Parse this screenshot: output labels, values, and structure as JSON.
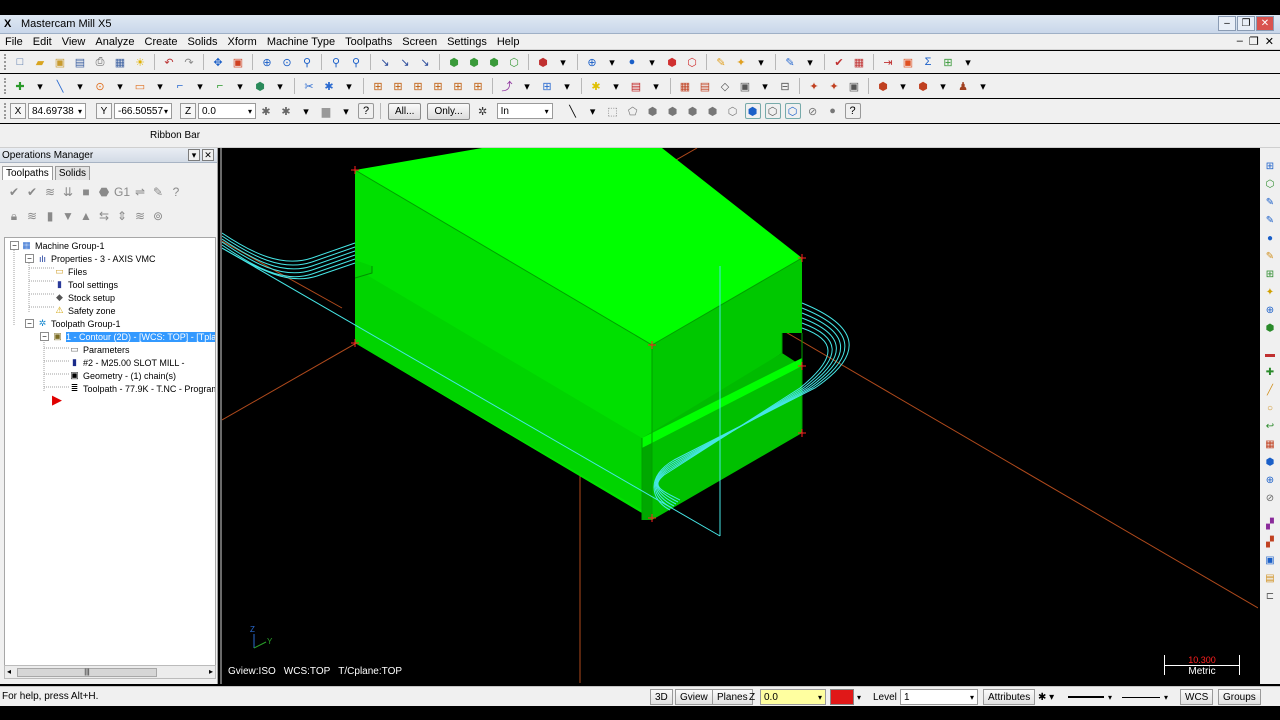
{
  "window": {
    "title": "Mastercam Mill X5",
    "controls": [
      "–",
      "❐",
      "✕"
    ]
  },
  "menubar": {
    "items": [
      "File",
      "Edit",
      "View",
      "Analyze",
      "Create",
      "Solids",
      "Xform",
      "Machine Type",
      "Toolpaths",
      "Screen",
      "Settings",
      "Help"
    ],
    "right": [
      "–",
      "❐",
      "✕"
    ]
  },
  "autocursor": {
    "x_label": "X",
    "x_value": "84.69738",
    "y_label": "Y",
    "y_value": "-66.50557",
    "z_label": "Z",
    "z_value": "0.0",
    "all_button": "All...",
    "only_button": "Only...",
    "mode_select": "In"
  },
  "ribbon": {
    "label": "Ribbon Bar"
  },
  "ops_manager": {
    "title": "Operations Manager",
    "tabs": [
      "Toolpaths",
      "Solids"
    ],
    "tree": [
      {
        "label": "Machine Group-1"
      },
      {
        "label": "Properties - 3 - AXIS VMC"
      },
      {
        "label": "Files"
      },
      {
        "label": "Tool settings"
      },
      {
        "label": "Stock setup"
      },
      {
        "label": "Safety zone"
      },
      {
        "label": "Toolpath Group-1"
      },
      {
        "label": "1 - Contour (2D) - [WCS: TOP] - [Tpla"
      },
      {
        "label": "Parameters"
      },
      {
        "label": "#2 - M25.00 SLOT MILL -"
      },
      {
        "label": "Geometry - (1) chain(s)"
      },
      {
        "label": "Toolpath - 77.9K - T.NC - Program"
      }
    ],
    "scroll_thumb": "|||"
  },
  "viewport": {
    "gview": "Gview:ISO",
    "wcs": "WCS:TOP",
    "tcplane": "T/Cplane:TOP",
    "axis_y": "Y",
    "axis_z": "Z",
    "scale_value": "10.300",
    "scale_unit": "Metric",
    "colors": {
      "part": "#00ff00",
      "toolpath": "#46e6e6",
      "axis_line": "#c04020"
    }
  },
  "statusbar": {
    "help": "For help, press Alt+H.",
    "btn_3d": "3D",
    "btn_gview": "Gview",
    "btn_planes": "Planes",
    "z_label": "Z",
    "z_value": "0.0",
    "color_swatch": "#e01818",
    "level_label": "Level",
    "level_value": "1",
    "attributes": "Attributes",
    "wcs": "WCS",
    "groups": "Groups"
  }
}
